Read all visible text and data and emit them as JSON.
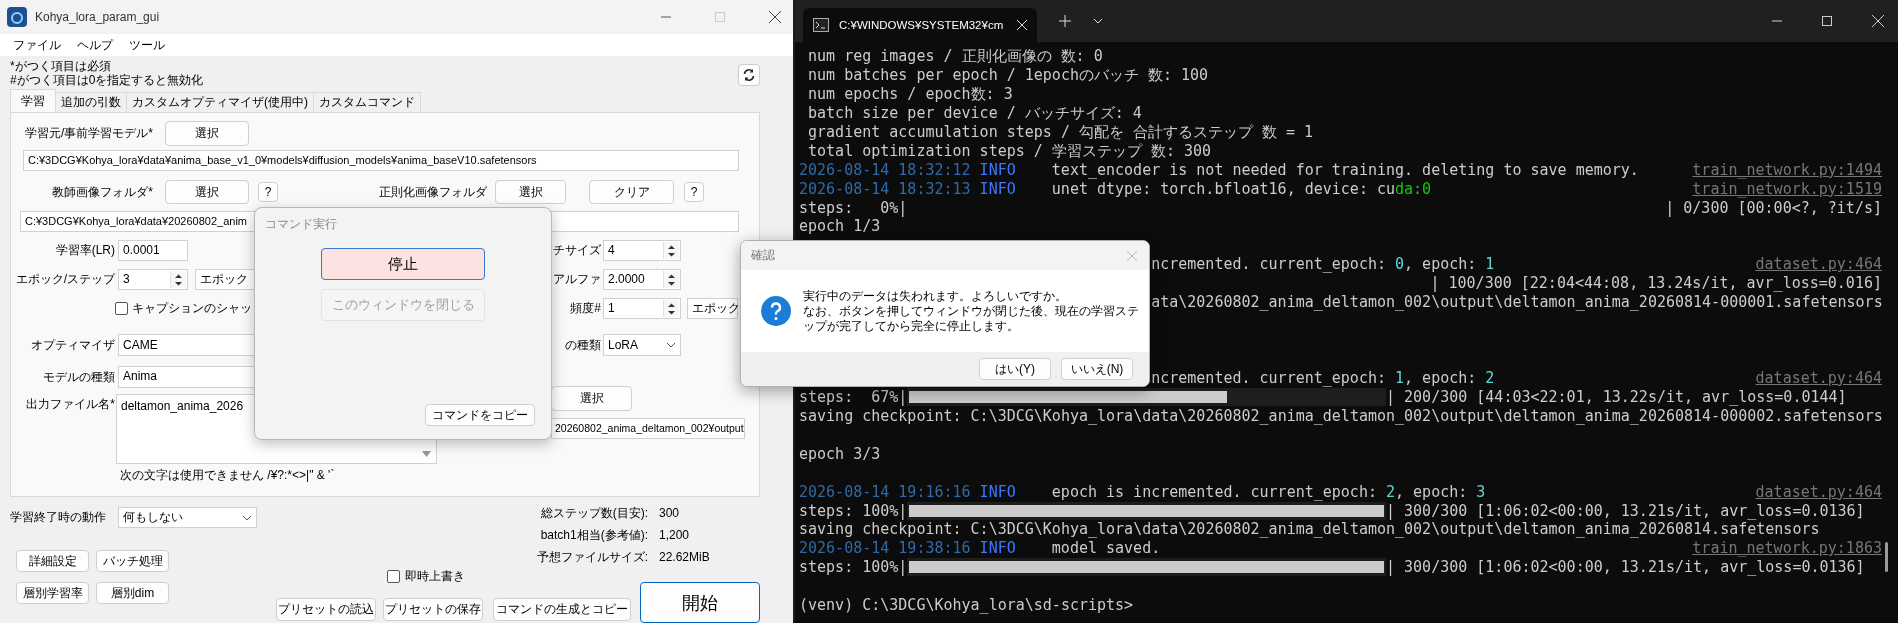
{
  "main_window": {
    "title": "Kohya_lora_param_gui",
    "menu": [
      "ファイル",
      "ヘルプ",
      "ツール"
    ],
    "notes": [
      "*がつく項目は必須",
      "#がつく項目は0を指定すると無効化"
    ],
    "tabs": [
      {
        "label": "学習",
        "selected": true
      },
      {
        "label": "追加の引数",
        "selected": false
      },
      {
        "label": "カスタムオプティマイザ(使用中)",
        "selected": false
      },
      {
        "label": "カスタムコマンド",
        "selected": false
      }
    ],
    "training": {
      "base_model": {
        "label": "学習元/事前学習モデル*",
        "button": "選択",
        "path": "C:¥3DCG¥Kohya_lora¥data¥anima_base_v1_0¥models¥diffusion_models¥anima_baseV10.safetensors"
      },
      "train_folder": {
        "label": "教師画像フォルダ*",
        "button": "選択",
        "help": "?",
        "path": "C:¥3DCG¥Kohya_lora¥data¥20260802_anim"
      },
      "reg_folder": {
        "label": "正則化画像フォルダ",
        "button": "選択",
        "clear": "クリア",
        "help": "?"
      },
      "learning_rate": {
        "label": "学習率(LR)",
        "value": "0.0001"
      },
      "epochs": {
        "label": "エポック/ステップ",
        "value": "3",
        "unit": "エポック"
      },
      "shuffle_caption": {
        "label": "キャプションのシャッ",
        "checked": false
      },
      "optimizer": {
        "label": "オプティマイザ",
        "value": "CAME"
      },
      "model_type": {
        "label": "モデルの種類",
        "value": "Anima"
      },
      "output_name": {
        "label": "出力ファイル名*",
        "value": "deltamon_anima_2026",
        "hint": "次の文字は使用できません /¥?:*<>|\" & '`"
      },
      "batch_size": {
        "label": "チサイズ",
        "value": "4"
      },
      "network_alpha": {
        "label": "アルファ",
        "value": "2.0000"
      },
      "save_every": {
        "label": "頻度#",
        "value": "1",
        "unit": "エポック"
      },
      "network_type": {
        "label": "の種類",
        "value": "LoRA"
      },
      "output_folder": {
        "button": "選択",
        "path": "20260802_anima_deltamon_002¥output"
      }
    },
    "on_finish": {
      "label": "学習終了時の動作",
      "value": "何もしない"
    },
    "stats": [
      {
        "label": "総ステップ数(目安):",
        "value": "300"
      },
      {
        "label": "batch1相当(参考値):",
        "value": "1,200"
      },
      {
        "label": "予想ファイルサイズ:",
        "value": "22.62MiB"
      }
    ],
    "buttons": [
      "詳細設定",
      "バッチ処理",
      "層別学習率",
      "層別dim"
    ],
    "overwrite": {
      "label": "即時上書き",
      "checked": false
    },
    "preset_buttons": [
      "プリセットの読込",
      "プリセットの保存"
    ],
    "generate_button": "コマンドの生成とコピー",
    "start_button": "開始"
  },
  "command_dialog": {
    "title": "コマンド実行",
    "stop": "停止",
    "close": {
      "label": "このウィンドウを閉じる",
      "disabled": true
    },
    "copy": "コマンドをコピー"
  },
  "confirm_dialog": {
    "title": "確認",
    "message": [
      "実行中のデータは失われます。よろしいですか。",
      "なお、ボタンを押してウィンドウが閉じた後、現在の学習ステップが完了してから完全に停止します。"
    ],
    "buttons": [
      "はい(Y)",
      "いいえ(N)"
    ]
  },
  "terminal": {
    "tab_title": "C:¥WINDOWS¥SYSTEM32¥cm",
    "lines": [
      {
        "kind": "indent",
        "text": "num reg images / 正則化画像の 数: 0"
      },
      {
        "kind": "indent",
        "text": "num batches per epoch / 1epochのバッチ 数: 100"
      },
      {
        "kind": "indent",
        "text": "num epochs / epoch数: 3"
      },
      {
        "kind": "indent",
        "text": "batch size per device / バッチサイズ: 4"
      },
      {
        "kind": "indent",
        "text": "gradient accumulation steps / 勾配を 合計するステップ 数 = 1"
      },
      {
        "kind": "indent",
        "text": "total optimization steps / 学習ステップ 数: 300"
      },
      {
        "kind": "log",
        "time": "2026-08-14 18:32:12",
        "level": "INFO",
        "parts": [
          {
            "text": "text_encoder is not needed for training. deleting to save memory."
          }
        ],
        "source": "train_network.py:1494"
      },
      {
        "kind": "log",
        "time": "2026-08-14 18:32:13",
        "level": "INFO",
        "parts": [
          {
            "text": "unet dtype: torch.bfloat16, device: cu"
          },
          {
            "text": "da:0",
            "color": "#16c60c"
          }
        ],
        "source": "train_network.py:1519"
      },
      {
        "kind": "split",
        "left": "steps:   0%|",
        "right": "| 0/300 [00:00<?, ?it/s]"
      },
      {
        "kind": "plain",
        "text": "epoch 1/3"
      },
      {
        "kind": "blank"
      },
      {
        "kind": "tail",
        "parts": [
          {
            "text": "ncremented. current_epoch: "
          },
          {
            "text": "0",
            "color": "#61d6d6"
          },
          {
            "text": ", epoch: "
          },
          {
            "text": "1",
            "color": "#61d6d6"
          }
        ],
        "source": "dataset.py:464"
      },
      {
        "kind": "right",
        "text": "| 100/300 [22:04<44:08, 13.24s/it, avr_loss=0.016]"
      },
      {
        "kind": "tail",
        "parts": [
          {
            "text": "ata\\20260802_anima_deltamon_002\\output\\deltamon_anima_20260814-000001.safetensors"
          }
        ]
      },
      {
        "kind": "blank"
      },
      {
        "kind": "blank"
      },
      {
        "kind": "blank"
      },
      {
        "kind": "tail",
        "parts": [
          {
            "text": "ncremented. current_epoch: "
          },
          {
            "text": "1",
            "color": "#61d6d6"
          },
          {
            "text": ", epoch: "
          },
          {
            "text": "2",
            "color": "#61d6d6"
          }
        ],
        "source": "dataset.py:464"
      },
      {
        "kind": "progress",
        "label": "steps:  67%|",
        "level": 0.67,
        "stats": "| 200/300 [44:03<22:01, 13.22s/it, avr_loss=0.0144]"
      },
      {
        "kind": "plain",
        "text": "saving checkpoint: C:\\3DCG\\Kohya_lora\\data\\20260802_anima_deltamon_002\\output\\deltamon_anima_20260814-000002.safetensors"
      },
      {
        "kind": "blank"
      },
      {
        "kind": "plain",
        "text": "epoch 3/3"
      },
      {
        "kind": "blank"
      },
      {
        "kind": "log",
        "time": "2026-08-14 19:16:16",
        "level": "INFO",
        "parts": [
          {
            "text": "epoch is incremented. current_epoch: "
          },
          {
            "text": "2",
            "color": "#61d6d6"
          },
          {
            "text": ", epoch: "
          },
          {
            "text": "3",
            "color": "#61d6d6"
          }
        ],
        "source": "dataset.py:464"
      },
      {
        "kind": "progress",
        "label": "steps: 100%|",
        "level": 1,
        "stats": "| 300/300 [1:06:02<00:00, 13.21s/it, avr_loss=0.0136]"
      },
      {
        "kind": "plain",
        "text": "saving checkpoint: C:\\3DCG\\Kohya_lora\\data\\20260802_anima_deltamon_002\\output\\deltamon_anima_20260814.safetensors"
      },
      {
        "kind": "log",
        "time": "2026-08-14 19:38:16",
        "level": "INFO",
        "parts": [
          {
            "text": "model saved."
          }
        ],
        "source": "train_network.py:1863"
      },
      {
        "kind": "progress",
        "label": "steps: 100%|",
        "level": 1,
        "stats": "| 300/300 [1:06:02<00:00, 13.21s/it, avr_loss=0.0136]"
      },
      {
        "kind": "blank"
      },
      {
        "kind": "plain",
        "text": "(venv) C:\\3DCG\\Kohya_lora\\sd-scripts>"
      }
    ]
  }
}
